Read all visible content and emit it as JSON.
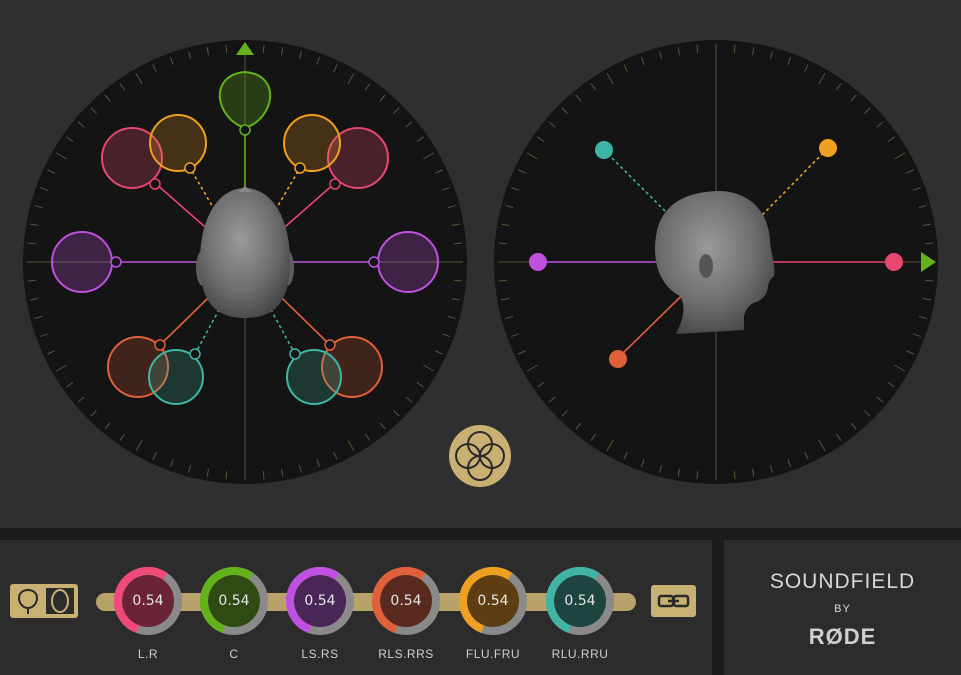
{
  "brand": {
    "line1": "SOUNDFIELD",
    "line2": "BY",
    "line3": "RØDE"
  },
  "colors": {
    "background": "#2f2f2f",
    "panel": "#141414",
    "gold": "#c8b173",
    "green": "#63b21a",
    "pink": "#e6466f",
    "magenta": "#c050e0",
    "orange_red": "#e0603a",
    "orange": "#f0a020",
    "teal": "#40b5a5",
    "orange_yellow": "#f0a020"
  },
  "knobs": [
    {
      "label": "L.R",
      "value": "0.54",
      "color": "#f04a7a",
      "fill": "#6a2436"
    },
    {
      "label": "C",
      "value": "0.54",
      "color": "#63b21a",
      "fill": "#304a14"
    },
    {
      "label": "LS.RS",
      "value": "0.54",
      "color": "#c050e0",
      "fill": "#4a2656"
    },
    {
      "label": "RLS.RRS",
      "value": "0.54",
      "color": "#e0603a",
      "fill": "#5a2a1e"
    },
    {
      "label": "FLU.FRU",
      "value": "0.54",
      "color": "#f0a020",
      "fill": "#5c3e12"
    },
    {
      "label": "RLU.RRU",
      "value": "0.54",
      "color": "#40b5a5",
      "fill": "#1e4440"
    }
  ],
  "icons": {
    "front_pattern": "cardioid-pattern-icon",
    "side_pattern": "oval-pattern-icon",
    "link": "link-icon",
    "center_logo": "soundfield-rings-icon",
    "front_marker": "triangle-up-icon",
    "side_marker": "triangle-right-icon"
  }
}
